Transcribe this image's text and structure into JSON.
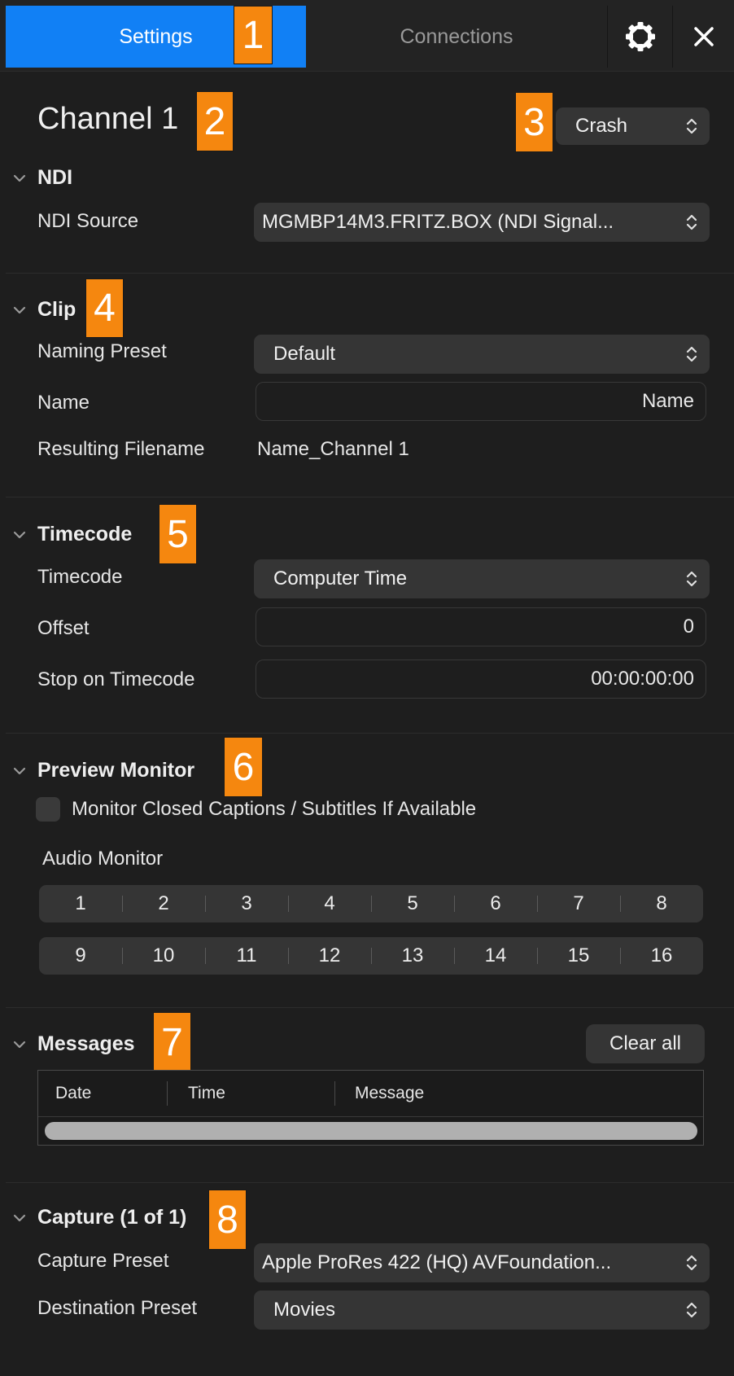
{
  "tabs": {
    "settings": "Settings",
    "connections": "Connections"
  },
  "icons": {
    "settings": "gear-icon",
    "close": "close-icon",
    "chevron": "chevron-down-icon",
    "stepper": "up-down-chevrons-icon"
  },
  "colors": {
    "accent": "#1180f5",
    "badge": "#f5870f",
    "background": "#1e1e1e",
    "control": "#353535"
  },
  "badges": [
    "1",
    "2",
    "3",
    "4",
    "5",
    "6",
    "7",
    "8"
  ],
  "channel": {
    "title": "Channel 1",
    "mode": "Crash"
  },
  "ndi": {
    "heading": "NDI",
    "source_label": "NDI Source",
    "source_value": "MGMBP14M3.FRITZ.BOX (NDI Signal..."
  },
  "clip": {
    "heading": "Clip",
    "naming_preset_label": "Naming Preset",
    "naming_preset_value": "Default",
    "name_label": "Name",
    "name_value": "Name",
    "filename_label": "Resulting Filename",
    "filename_value": "Name_Channel 1"
  },
  "timecode": {
    "heading": "Timecode",
    "timecode_label": "Timecode",
    "timecode_value": "Computer Time",
    "offset_label": "Offset",
    "offset_value": "0",
    "stop_label": "Stop on Timecode",
    "stop_value": "00:00:00:00"
  },
  "preview": {
    "heading": "Preview Monitor",
    "captions_label": "Monitor Closed Captions / Subtitles If Available",
    "captions_checked": false,
    "audio_label": "Audio Monitor",
    "audio_row1": [
      "1",
      "2",
      "3",
      "4",
      "5",
      "6",
      "7",
      "8"
    ],
    "audio_row2": [
      "9",
      "10",
      "11",
      "12",
      "13",
      "14",
      "15",
      "16"
    ]
  },
  "messages": {
    "heading": "Messages",
    "clear_label": "Clear all",
    "columns": [
      "Date",
      "Time",
      "Message"
    ]
  },
  "capture": {
    "heading": "Capture (1 of 1)",
    "capture_preset_label": "Capture Preset",
    "capture_preset_value": "Apple ProRes 422 (HQ) AVFoundation...",
    "destination_label": "Destination Preset",
    "destination_value": "Movies"
  }
}
